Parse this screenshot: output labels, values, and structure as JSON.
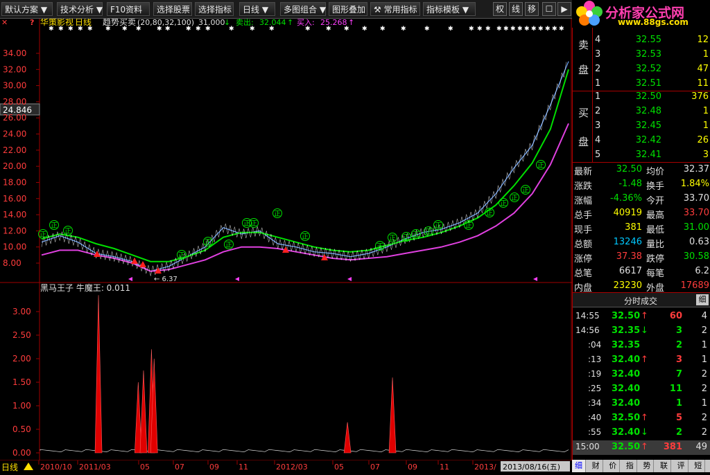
{
  "toolbar": {
    "items": [
      "默认方案",
      "技术分析",
      "F10资料",
      "选择股票",
      "选择指标",
      "日线",
      "多图组合",
      "图形叠加",
      "常用指标",
      "指标模板"
    ],
    "right_buttons": [
      "权",
      "线",
      "移",
      "☐",
      "▶",
      "✕"
    ]
  },
  "logo": {
    "title": "分析家公式网",
    "url": "www.88gs.com"
  },
  "main_chart": {
    "stock_name": "华策影视",
    "period": "日线",
    "indicator_name": "趋势买卖",
    "indicator_params": "(20,80,32,100)",
    "indicator_value": "31.000",
    "sell_label": "卖出:",
    "sell_value": "32.044",
    "buy_label": "买入:",
    "buy_value": "25.268",
    "price_marker": "24.846",
    "low_label": "← 6.37",
    "y_ticks": [
      "34.00",
      "32.00",
      "30.00",
      "28.00",
      "26.00",
      "24.00",
      "22.00",
      "20.00",
      "18.00",
      "16.00",
      "14.00",
      "12.00",
      "10.00",
      "8.00"
    ],
    "signal_text": "正"
  },
  "sub_chart": {
    "title": "黑马王子  牛魔王: 0.011",
    "y_ticks": [
      "3.00",
      "2.50",
      "2.00",
      "1.50",
      "1.00",
      "0.50",
      "0.00"
    ]
  },
  "x_axis": {
    "labels": [
      "2010/10",
      "2011/03",
      "05",
      "07",
      "09",
      "11",
      "2012/03",
      "05",
      "07",
      "09",
      "11",
      "2013/"
    ],
    "current_date": "2013/08/16(五)",
    "period_label": "日线"
  },
  "chart_data": [
    {
      "type": "line",
      "title": "华策影视 日线 趋势买卖",
      "series": [
        {
          "name": "收盘",
          "values": [
            10.6,
            11.4,
            10.6,
            9.2,
            8.8,
            8.2,
            7.0,
            7.6,
            8.8,
            10.0,
            12.4,
            11.6,
            12.0,
            10.4,
            10.0,
            9.4,
            9.2,
            8.8,
            9.2,
            10.0,
            11.0,
            11.8,
            12.2,
            13.0,
            14.2,
            16.6,
            19.8,
            22.6,
            27.6,
            33.0
          ]
        },
        {
          "name": "卖出",
          "values": [
            11.0,
            11.6,
            11.2,
            10.4,
            9.8,
            9.0,
            8.2,
            8.2,
            8.8,
            9.6,
            11.2,
            11.8,
            11.8,
            11.2,
            10.6,
            10.0,
            9.6,
            9.4,
            9.6,
            10.2,
            10.8,
            11.2,
            11.8,
            12.6,
            13.6,
            15.2,
            17.6,
            20.4,
            24.6,
            32.0
          ]
        },
        {
          "name": "买入",
          "values": [
            9.0,
            9.6,
            9.6,
            9.0,
            8.6,
            8.0,
            7.0,
            7.2,
            7.8,
            8.4,
            9.4,
            10.0,
            10.0,
            9.8,
            9.4,
            9.0,
            8.6,
            8.4,
            8.6,
            8.8,
            9.2,
            9.6,
            10.0,
            10.6,
            11.4,
            12.6,
            14.2,
            16.6,
            20.2,
            25.3
          ]
        }
      ],
      "ylim": [
        7,
        35
      ]
    },
    {
      "type": "bar",
      "title": "黑马王子 牛魔王",
      "spikes": [
        {
          "x": 0.11,
          "value": 3.35
        },
        {
          "x": 0.185,
          "value": 1.5
        },
        {
          "x": 0.195,
          "value": 1.75
        },
        {
          "x": 0.21,
          "value": 2.2
        },
        {
          "x": 0.215,
          "value": 2.0
        },
        {
          "x": 0.58,
          "value": 0.65
        },
        {
          "x": 0.665,
          "value": 1.6
        }
      ],
      "ylim": [
        0,
        3.4
      ]
    }
  ],
  "order_book": {
    "sell_label": [
      "卖",
      "盘"
    ],
    "buy_label": [
      "买",
      "盘"
    ],
    "sell": [
      {
        "level": "4",
        "price": "32.55",
        "vol": "12"
      },
      {
        "level": "3",
        "price": "32.53",
        "vol": "1"
      },
      {
        "level": "2",
        "price": "32.52",
        "vol": "47"
      },
      {
        "level": "1",
        "price": "32.51",
        "vol": "11"
      }
    ],
    "buy": [
      {
        "level": "1",
        "price": "32.50",
        "vol": "376"
      },
      {
        "level": "2",
        "price": "32.48",
        "vol": "1"
      },
      {
        "level": "3",
        "price": "32.45",
        "vol": "1"
      },
      {
        "level": "4",
        "price": "32.42",
        "vol": "26"
      },
      {
        "level": "5",
        "price": "32.41",
        "vol": "3"
      }
    ]
  },
  "quote": [
    {
      "l1": "最新",
      "v1": "32.50",
      "l2": "均价",
      "v2": "32.37"
    },
    {
      "l1": "涨跌",
      "v1": "-1.48",
      "l2": "换手",
      "v2": "1.84%"
    },
    {
      "l1": "涨幅",
      "v1": "-4.36%",
      "l2": "今开",
      "v2": "33.70"
    },
    {
      "l1": "总手",
      "v1": "40919",
      "l2": "最高",
      "v2": "33.70"
    },
    {
      "l1": "现手",
      "v1": "381",
      "l2": "最低",
      "v2": "31.00"
    },
    {
      "l1": "总额",
      "v1": "13246",
      "l2": "量比",
      "v2": "0.63"
    },
    {
      "l1": "涨停",
      "v1": "37.38",
      "l2": "跌停",
      "v2": "30.58"
    },
    {
      "l1": "总笔",
      "v1": "6617",
      "l2": "每笔",
      "v2": "6.2"
    },
    {
      "l1": "内盘",
      "v1": "23230",
      "l2": "外盘",
      "v2": "17689"
    }
  ],
  "ticks": {
    "header": "分时成交",
    "header_btn": "细",
    "rows": [
      {
        "time": "14:55",
        "price": "32.50",
        "arrow": "↑",
        "vol": "60",
        "n": "4"
      },
      {
        "time": "14:56",
        "price": "32.35",
        "arrow": "↓",
        "vol": "3",
        "n": "2"
      },
      {
        "time": ":04",
        "price": "32.35",
        "arrow": "",
        "vol": "2",
        "n": "1"
      },
      {
        "time": ":13",
        "price": "32.40",
        "arrow": "↑",
        "vol": "3",
        "n": "1"
      },
      {
        "time": ":19",
        "price": "32.40",
        "arrow": "",
        "vol": "7",
        "n": "2"
      },
      {
        "time": ":25",
        "price": "32.40",
        "arrow": "",
        "vol": "11",
        "n": "2"
      },
      {
        "time": ":34",
        "price": "32.40",
        "arrow": "",
        "vol": "1",
        "n": "1"
      },
      {
        "time": ":40",
        "price": "32.50",
        "arrow": "↑",
        "vol": "5",
        "n": "2"
      },
      {
        "time": ":55",
        "price": "32.40",
        "arrow": "↓",
        "vol": "2",
        "n": "2"
      },
      {
        "time": "15:00",
        "price": "32.50",
        "arrow": "↑",
        "vol": "381",
        "n": "49"
      }
    ]
  },
  "bottom_tabs": [
    "细",
    "财",
    "价",
    "指",
    "势",
    "联",
    "评",
    "短"
  ]
}
